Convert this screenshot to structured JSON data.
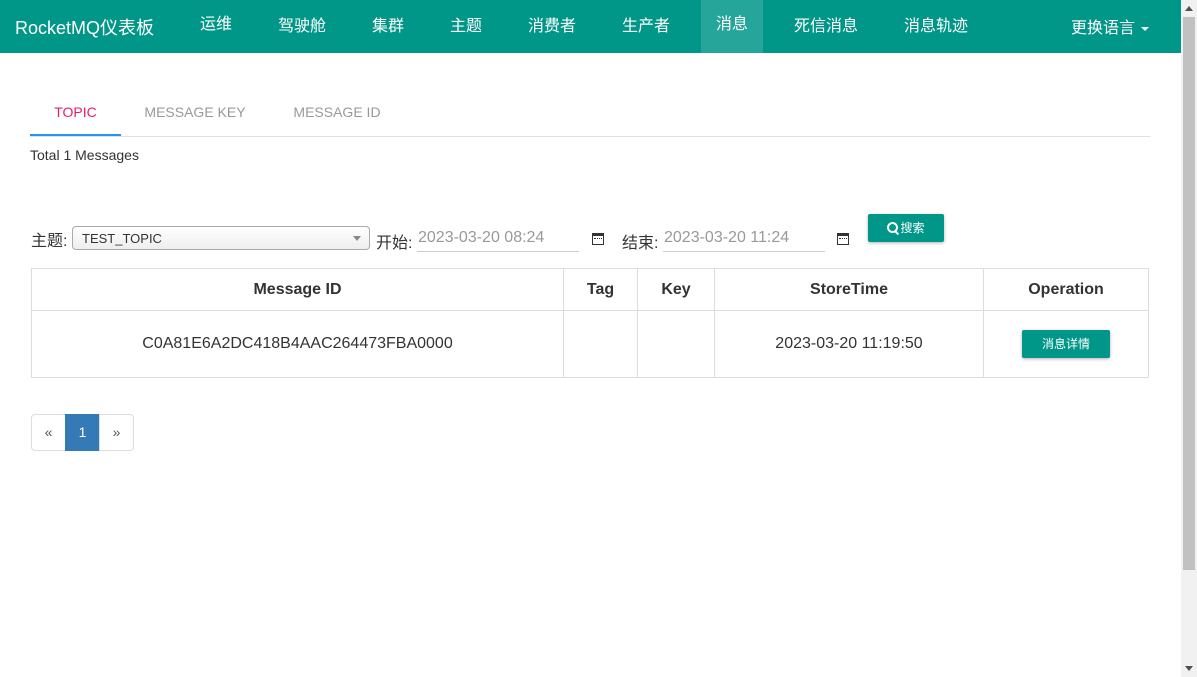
{
  "navbar": {
    "brand": "RocketMQ仪表板",
    "items": [
      {
        "label": "运维"
      },
      {
        "label": "驾驶舱"
      },
      {
        "label": "集群"
      },
      {
        "label": "主题"
      },
      {
        "label": "消费者"
      },
      {
        "label": "生产者"
      },
      {
        "label": "消息",
        "active": true
      },
      {
        "label": "死信消息"
      },
      {
        "label": "消息轨迹"
      }
    ],
    "language": "更换语言"
  },
  "tabs": [
    {
      "label": "TOPIC",
      "active": true
    },
    {
      "label": "MESSAGE KEY"
    },
    {
      "label": "MESSAGE ID"
    }
  ],
  "total": "Total 1 Messages",
  "filter": {
    "topic_label": "主题:",
    "topic_value": "TEST_TOPIC",
    "start_label": "开始:",
    "start_value": "2023-03-20 08:24",
    "end_label": "结束:",
    "end_value": "2023-03-20 11:24",
    "search_label": "搜索"
  },
  "table": {
    "headers": [
      "Message ID",
      "Tag",
      "Key",
      "StoreTime",
      "Operation"
    ],
    "rows": [
      {
        "message_id": "C0A81E6A2DC418B4AAC264473FBA0000",
        "tag": "",
        "key": "",
        "store_time": "2023-03-20 11:19:50",
        "operation": "消息详情"
      }
    ]
  },
  "pagination": {
    "prev": "«",
    "current": "1",
    "next": "»"
  },
  "colors": {
    "primary": "#009688",
    "active_tab_text": "#e91e63",
    "tab_underline": "#2196f3",
    "page_active": "#337ab7"
  }
}
